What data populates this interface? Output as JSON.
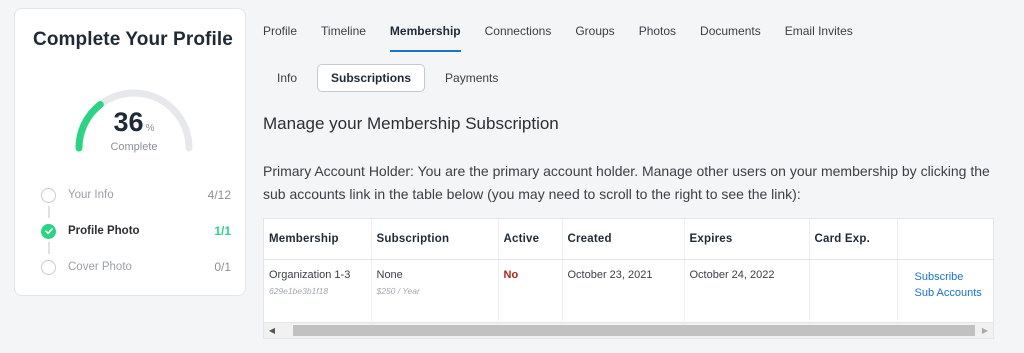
{
  "profile_card": {
    "title": "Complete Your Profile",
    "progress_value": "36",
    "progress_unit": "%",
    "progress_label": "Complete",
    "progress_fraction": 0.36,
    "accent_color": "#2bd385",
    "steps": [
      {
        "label": "Your Info",
        "value": "4/12",
        "done": false
      },
      {
        "label": "Profile Photo",
        "value": "1/1",
        "done": true
      },
      {
        "label": "Cover Photo",
        "value": "0/1",
        "done": false
      }
    ]
  },
  "tabs": [
    "Profile",
    "Timeline",
    "Membership",
    "Connections",
    "Groups",
    "Photos",
    "Documents",
    "Email Invites"
  ],
  "active_tab": "Membership",
  "subtabs": [
    "Info",
    "Subscriptions",
    "Payments"
  ],
  "active_subtab": "Subscriptions",
  "section_title": "Manage your Membership Subscription",
  "description": "Primary Account Holder: You are the primary account holder. Manage other users on your membership by clicking the sub accounts link in the table below (you may need to scroll to the right to see the link):",
  "table": {
    "headers": [
      "Membership",
      "Subscription",
      "Active",
      "Created",
      "Expires",
      "Card Exp.",
      ""
    ],
    "row": {
      "membership": "Organization 1-3",
      "membership_id": "629e1be3b1f18",
      "subscription": "None",
      "subscription_price": "$250 / Year",
      "active": "No",
      "created": "October 23, 2021",
      "expires": "October 24, 2022",
      "card_exp": "",
      "link_subscribe": "Subscribe",
      "link_sub_accounts": "Sub Accounts"
    }
  },
  "link_color": "#1a73c8"
}
